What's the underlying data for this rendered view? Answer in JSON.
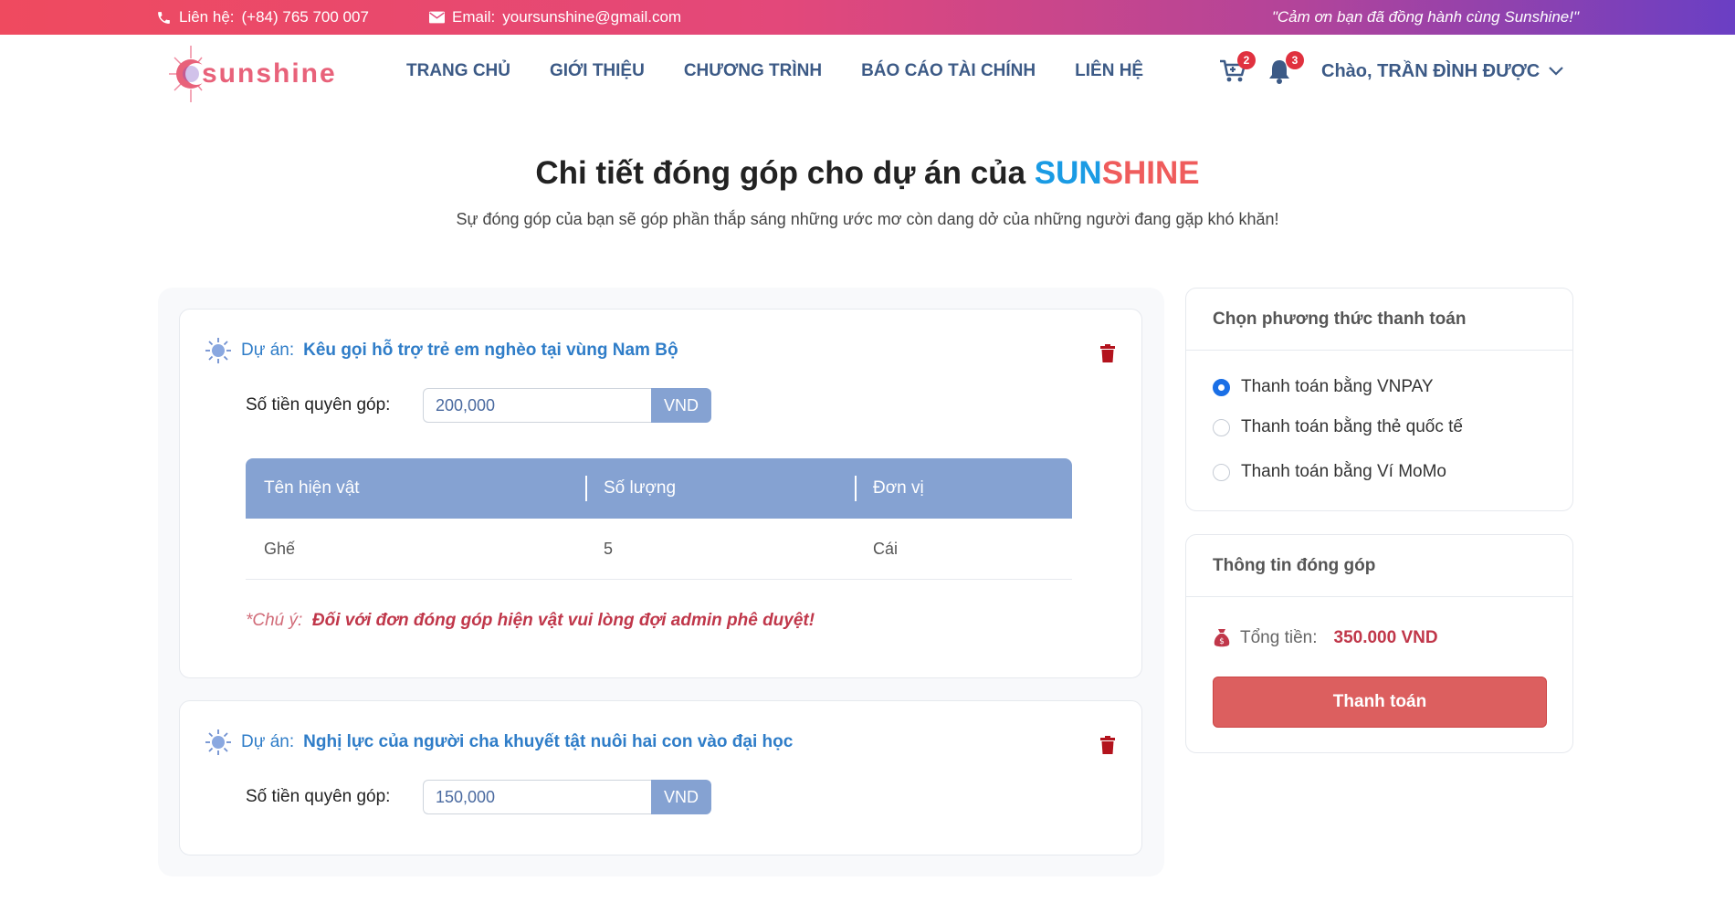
{
  "topbar": {
    "phone_label": "Liên hệ:",
    "phone": "(+84) 765 700 007",
    "email_label": "Email:",
    "email": "yoursunshine@gmail.com",
    "thanks": "\"Cảm ơn bạn đã đồng hành cùng Sunshine!\""
  },
  "header": {
    "logo_text": "sunshine",
    "nav": [
      "TRANG CHỦ",
      "GIỚI THIỆU",
      "CHƯƠNG TRÌNH",
      "BÁO CÁO TÀI CHÍNH",
      "LIÊN HỆ"
    ],
    "cart_count": "2",
    "notif_count": "3",
    "user_greeting": "Chào, TRẦN ĐÌNH ĐƯỢC"
  },
  "hero": {
    "title": "Chi tiết đóng góp cho dự án của",
    "brand_a": "SUN",
    "brand_b": "SHINE",
    "subtitle": "Sự đóng góp của bạn sẽ góp phần thắp sáng những ước mơ còn dang dở của những người đang gặp khó khăn!"
  },
  "contributions": [
    {
      "project_label": "Dự án:",
      "project_name": "Kêu gọi hỗ trợ trẻ em nghèo tại vùng Nam Bộ",
      "amount_label": "Số tiền quyên góp:",
      "amount": "200,000",
      "currency": "VND",
      "table_headers": [
        "Tên hiện vật",
        "Số lượng",
        "Đơn vị"
      ],
      "rows": [
        [
          "Ghế",
          "5",
          "Cái"
        ]
      ],
      "note_prefix": "*Chú ý:",
      "note": "Đối với đơn đóng góp hiện vật vui lòng đợi admin phê duyệt!"
    },
    {
      "project_label": "Dự án:",
      "project_name": "Nghị lực của người cha khuyết tật nuôi hai con vào đại học",
      "amount_label": "Số tiền quyên góp:",
      "amount": "150,000",
      "currency": "VND"
    }
  ],
  "payment": {
    "title": "Chọn phương thức thanh toán",
    "options": [
      "Thanh toán bằng VNPAY",
      "Thanh toán bằng thẻ quốc tế",
      "Thanh toán bằng Ví MoMo"
    ],
    "selected_index": 0
  },
  "summary": {
    "title": "Thông tin đóng góp",
    "total_label": "Tổng tiền:",
    "total_value": "350.000 VND",
    "button_label": "Thanh toán"
  },
  "colors": {
    "accent": "#85a2d2",
    "nav": "#3c5a86",
    "danger": "#dc5f5f",
    "brand_blue": "#1a9be4",
    "brand_red": "#ef5c5c"
  }
}
